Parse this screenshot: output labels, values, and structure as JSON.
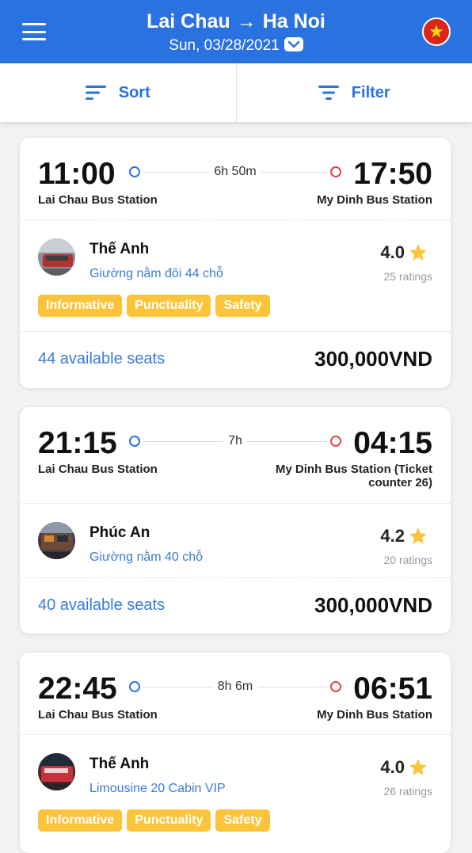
{
  "header": {
    "origin": "Lai Chau",
    "arrow": "→",
    "destination": "Ha Noi",
    "date": "Sun, 03/28/2021",
    "menu_icon": "hamburger-menu-icon",
    "flag_icon": "vietnam-flag-icon",
    "flag_star": "★",
    "color": "#2a72e0"
  },
  "toolbar": {
    "sort_label": "Sort",
    "filter_label": "Filter"
  },
  "trips": [
    {
      "departure_time": "11:00",
      "arrival_time": "17:50",
      "duration": "6h 50m",
      "departure_station": "Lai Chau Bus Station",
      "arrival_station": "My Dinh Bus Station",
      "operator": "Thế Anh",
      "bus_type": "Giường nằm đôi 44 chỗ",
      "rating": "4.0",
      "ratings_count": "25 ratings",
      "tags": [
        "Informative",
        "Punctuality",
        "Safety"
      ],
      "available_seats": "44 available seats",
      "price": "300,000VND"
    },
    {
      "departure_time": "21:15",
      "arrival_time": "04:15",
      "duration": "7h",
      "departure_station": "Lai Chau Bus Station",
      "arrival_station": "My Dinh Bus Station (Ticket counter 26)",
      "operator": "Phúc An",
      "bus_type": "Giường nằm 40 chỗ",
      "rating": "4.2",
      "ratings_count": "20 ratings",
      "tags": [],
      "available_seats": "40 available seats",
      "price": "300,000VND"
    },
    {
      "departure_time": "22:45",
      "arrival_time": "06:51",
      "duration": "8h 6m",
      "departure_station": "Lai Chau Bus Station",
      "arrival_station": "My Dinh Bus Station",
      "operator": "Thế Anh",
      "bus_type": "Limousine 20 Cabin VIP",
      "rating": "4.0",
      "ratings_count": "26 ratings",
      "tags": [
        "Informative",
        "Punctuality",
        "Safety"
      ]
    }
  ],
  "colors": {
    "primary": "#2a72e0",
    "tag": "#fbc43a",
    "star": "#fbc43a",
    "origin_dot": "#2a72e0",
    "destination_dot": "#e0454c"
  }
}
